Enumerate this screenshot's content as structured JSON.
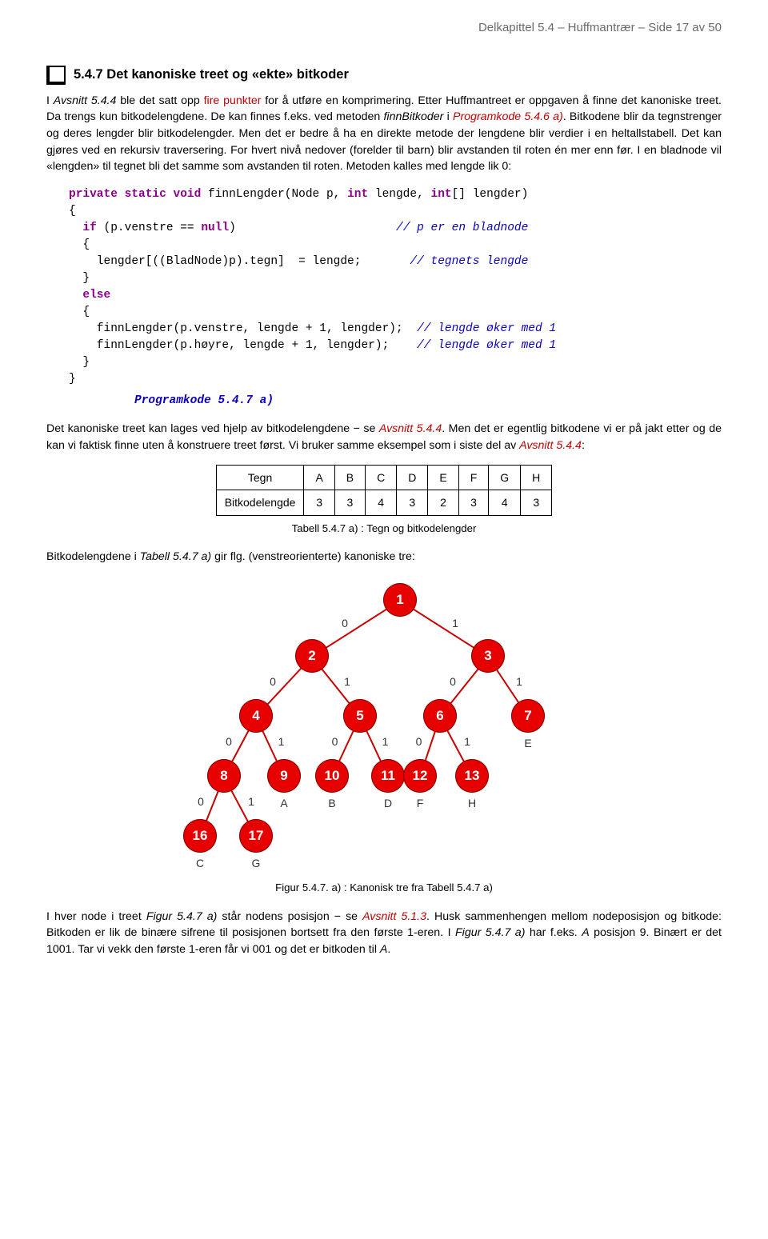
{
  "header": "Delkapittel 5.4 – Huffmantrær   –   Side 17 av 50",
  "section_title": "5.4.7  Det kanoniske treet og «ekte» bitkoder",
  "para1_pre": "I ",
  "para1_av": "Avsnitt 5.4.4",
  "para1_post": " ble det satt opp ",
  "para1_fire": "fire punkter",
  "para1_rest": " for å utføre en komprimering. Etter Huffmantreet er oppgaven å finne det kanoniske treet. Da trengs kun bitkodelengdene. De kan finnes f.eks. ved metoden ",
  "para1_fn": "finnBitkoder",
  "para1_rest2": " i ",
  "para1_pk": "Programkode 5.4.6 a)",
  "para1_rest3": ". Bitkodene blir da tegnstrenger og deres lengder blir bitkodelengder. Men det er bedre å ha en direkte metode der lengdene blir verdier i en heltallstabell. Det kan gjøres ved en rekursiv traversering. For hvert nivå nedover (forelder til barn) blir avstanden til roten én mer enn før. I en bladnode vil «lengden» til tegnet bli det samme som avstanden til roten. Metoden kalles med lengde lik 0:",
  "code": {
    "l1a": "private static void",
    "l1b": " finnLengder(Node p, ",
    "l1c": "int",
    "l1d": " lengde, ",
    "l1e": "int",
    "l1f": "[] lengder)",
    "l2": "{",
    "l3a": "  if",
    "l3b": " (p.venstre == ",
    "l3c": "null",
    "l3d": ")",
    "l3e": "// p er en bladnode",
    "l4": "  {",
    "l5a": "    lengder[((BladNode)p).tegn]  = lengde;",
    "l5b": "// tegnets lengde",
    "l6": "  }",
    "l7": "  else",
    "l8": "  {",
    "l9a": "    finnLengder(p.venstre, lengde + 1, lengder);",
    "l9b": "// lengde øker med 1",
    "l10a": "    finnLengder(p.høyre, lengde + 1, lengder);",
    "l10b": "// lengde øker med 1",
    "l11": "  }",
    "l12": "}"
  },
  "code_caption": "Programkode 5.4.7 a)",
  "para2_a": "Det kanoniske treet kan lages ved hjelp av bitkodelengdene − se ",
  "para2_link1": "Avsnitt 5.4.4",
  "para2_b": ". Men det er egentlig bitkodene vi er på jakt etter og de kan vi faktisk finne uten å konstruere treet først. Vi bruker samme eksempel som i siste del av ",
  "para2_link2": "Avsnitt 5.4.4",
  "para2_c": ":",
  "table": {
    "row1_label": "Tegn",
    "row1": [
      "A",
      "B",
      "C",
      "D",
      "E",
      "F",
      "G",
      "H"
    ],
    "row2_label": "Bitkodelengde",
    "row2": [
      "3",
      "3",
      "4",
      "3",
      "2",
      "3",
      "4",
      "3"
    ]
  },
  "table_caption": "Tabell 5.4.7 a) : Tegn og bitkodelengder",
  "para3_a": "Bitkodelengdene i ",
  "para3_it": "Tabell 5.4.7 a)",
  "para3_b": " gir flg. (venstreorienterte) kanoniske tre:",
  "tree_nodes": {
    "n1": "1",
    "n2": "2",
    "n3": "3",
    "n4": "4",
    "n5": "5",
    "n6": "6",
    "n7": "7",
    "n8": "8",
    "n9": "9",
    "n10": "10",
    "n11": "11",
    "n12": "12",
    "n13": "13",
    "n16": "16",
    "n17": "17"
  },
  "tree_leaves": {
    "E": "E",
    "A": "A",
    "B": "B",
    "D": "D",
    "F": "F",
    "H": "H",
    "C": "C",
    "G": "G"
  },
  "tree_edgelabels": {
    "z": "0",
    "o": "1"
  },
  "fig_caption": "Figur 5.4.7. a) : Kanonisk tre fra Tabell 5.4.7 a)",
  "para4_a": "I hver node i treet ",
  "para4_it1": "Figur 5.4.7 a)",
  "para4_b": " står nodens posisjon − se ",
  "para4_link": "Avsnitt 5.1.3",
  "para4_c": ". Husk sammen­hengen mellom nodeposisjon og bitkode: Bitkoden er lik de binære sifrene til posisjonen bortsett fra den første 1-eren. I ",
  "para4_it2": "Figur 5.4.7 a)",
  "para4_d": " har f.eks. ",
  "para4_A": "A",
  "para4_e": " posisjon 9. Binært er det 1001. Tar vi vekk den første 1-eren får vi 001 og det er bitkoden til ",
  "para4_A2": "A",
  "para4_f": "."
}
